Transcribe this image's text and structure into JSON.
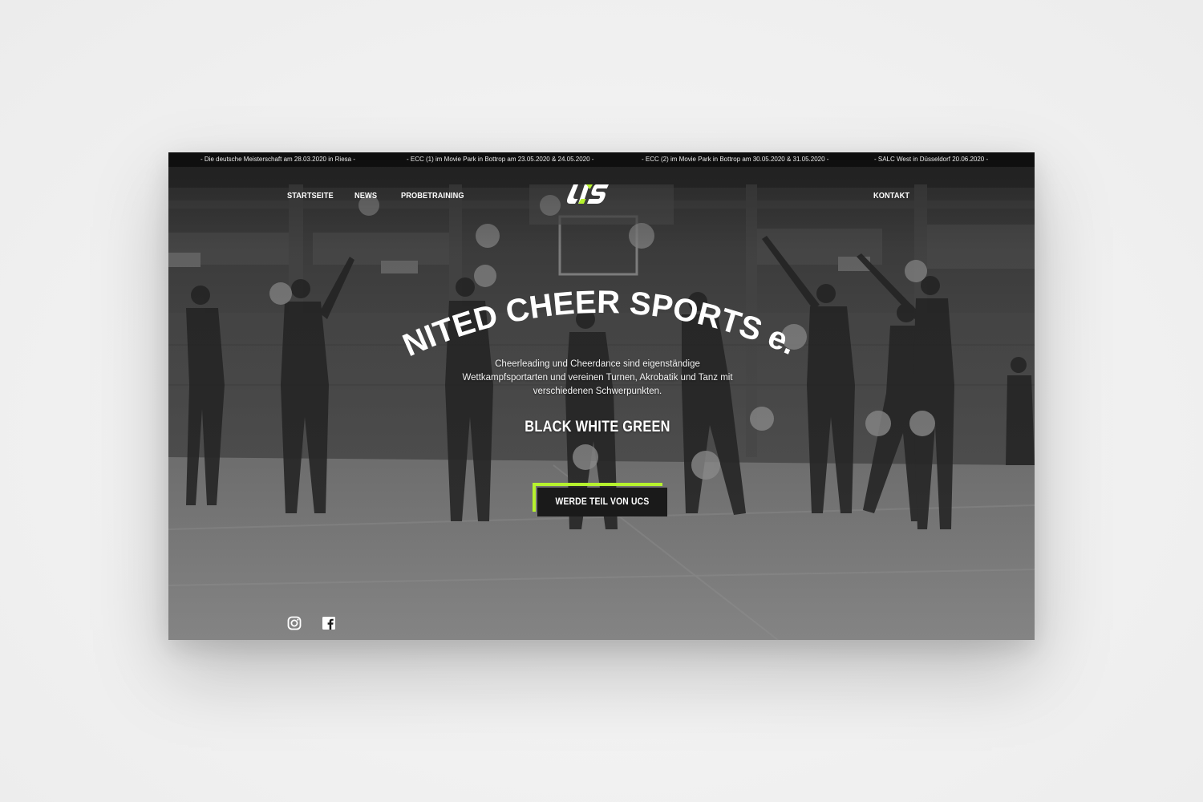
{
  "ticker": {
    "items": [
      "- Die deutsche Meisterschaft am 28.03.2020 in Riesa -",
      "- ECC (1) im Movie Park in Bottrop am 23.05.2020 & 24.05.2020 -",
      "- ECC (2) im Movie Park in Bottrop am 30.05.2020 & 31.05.2020 -",
      "- SALC West in Düsseldorf 20.06.2020 -"
    ]
  },
  "nav": {
    "left": [
      "STARTSEITE",
      "NEWS",
      "PROBETRAINING"
    ],
    "right": "KONTAKT"
  },
  "logo": {
    "text": "UCS",
    "accent_color": "#b6f22e"
  },
  "hero": {
    "title": "UNITED CHEER SPORTS e.V.",
    "description": "Cheerleading und Cheerdance sind eigenständige Wettkampfsportarten und vereinen Turnen, Akrobatik und Tanz mit verschiedenen Schwerpunkten.",
    "subtitle": "BLACK WHITE GREEN",
    "cta_label": "WERDE TEIL VON UCS"
  },
  "social": {
    "icons": [
      "instagram-icon",
      "facebook-icon"
    ]
  },
  "colors": {
    "accent": "#b6f22e",
    "button_bg": "#1a1a1a",
    "ticker_bg": "#0a0a0a"
  }
}
